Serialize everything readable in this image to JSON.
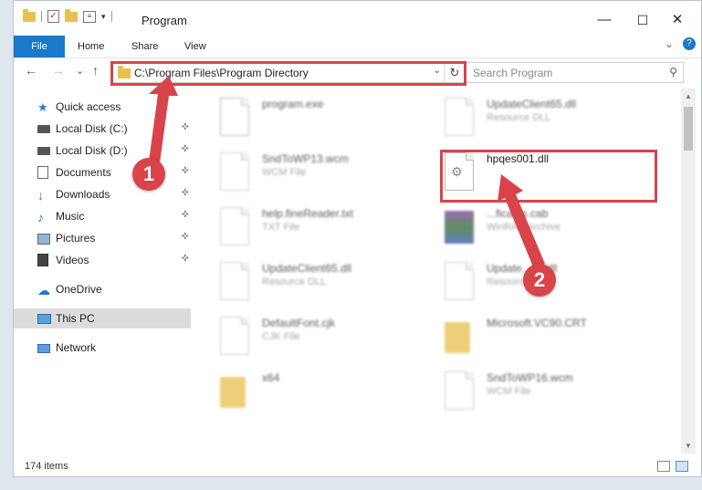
{
  "window": {
    "title": "Program"
  },
  "ribbon": {
    "tabs": [
      "File",
      "Home",
      "Share",
      "View"
    ],
    "help": "?"
  },
  "address": {
    "path": "C:\\Program Files\\Program Directory",
    "dropdown": "⌄",
    "refresh": "↻"
  },
  "search": {
    "placeholder": "Search Program"
  },
  "nav": {
    "back": "←",
    "forward": "→",
    "recent": "⌄",
    "up": "↑"
  },
  "window_controls": {
    "minimize": "—",
    "maximize": "☐",
    "close": "✕"
  },
  "sidebar": {
    "items": [
      {
        "label": "Quick access",
        "icon": "star-icon"
      },
      {
        "label": "Local Disk (C:)",
        "icon": "drive-icon",
        "pinned": true
      },
      {
        "label": "Local Disk (D:)",
        "icon": "drive-icon",
        "pinned": true
      },
      {
        "label": "Documents",
        "icon": "documents-icon",
        "pinned": true
      },
      {
        "label": "Downloads",
        "icon": "download-icon",
        "pinned": true
      },
      {
        "label": "Music",
        "icon": "music-icon",
        "pinned": true
      },
      {
        "label": "Pictures",
        "icon": "pictures-icon",
        "pinned": true
      },
      {
        "label": "Videos",
        "icon": "videos-icon",
        "pinned": true
      },
      {
        "label": "OneDrive",
        "icon": "cloud-icon"
      },
      {
        "label": "This PC",
        "icon": "computer-icon"
      },
      {
        "label": "Network",
        "icon": "network-icon"
      }
    ],
    "pin": "📌"
  },
  "files": [
    {
      "name": "program.exe",
      "type": ""
    },
    {
      "name": "UpdateClient65.dll",
      "type": "Resource DLL"
    },
    {
      "name": "SndToWP13.wcm",
      "type": "WCM File"
    },
    {
      "name": "hpqes001.dll",
      "type": ""
    },
    {
      "name": "help.fineReader.txt",
      "type": "TXT File"
    },
    {
      "name": "...ficates.cab",
      "type": "WinRAR Archive"
    },
    {
      "name": "UpdateClient65.dll",
      "type": "Resource DLL"
    },
    {
      "name": "Update...09.dll",
      "type": "Resource DLL"
    },
    {
      "name": "DefaultFont.cjk",
      "type": "CJK File"
    },
    {
      "name": "Microsoft.VC90.CRT",
      "type": ""
    },
    {
      "name": "x64",
      "type": ""
    },
    {
      "name": "SndToWP16.wcm",
      "type": "WCM File"
    }
  ],
  "callouts": [
    "1",
    "2"
  ],
  "status": {
    "items": "174 items"
  },
  "colors": {
    "accent": "#1979ca",
    "highlight": "#d9434a"
  }
}
